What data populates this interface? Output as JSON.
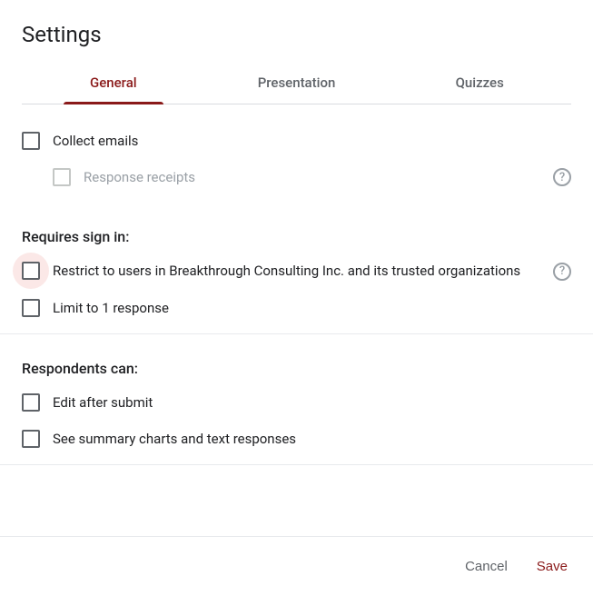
{
  "title": "Settings",
  "tabs": {
    "general": "General",
    "presentation": "Presentation",
    "quizzes": "Quizzes"
  },
  "options": {
    "collect_emails": "Collect emails",
    "response_receipts": "Response receipts",
    "requires_signin_heading": "Requires sign in:",
    "restrict_users": "Restrict to users in Breakthrough Consulting Inc. and its trusted organizations",
    "limit_response": "Limit to 1 response",
    "respondents_heading": "Respondents can:",
    "edit_after_submit": "Edit after submit",
    "see_summary": "See summary charts and text responses"
  },
  "buttons": {
    "cancel": "Cancel",
    "save": "Save"
  }
}
